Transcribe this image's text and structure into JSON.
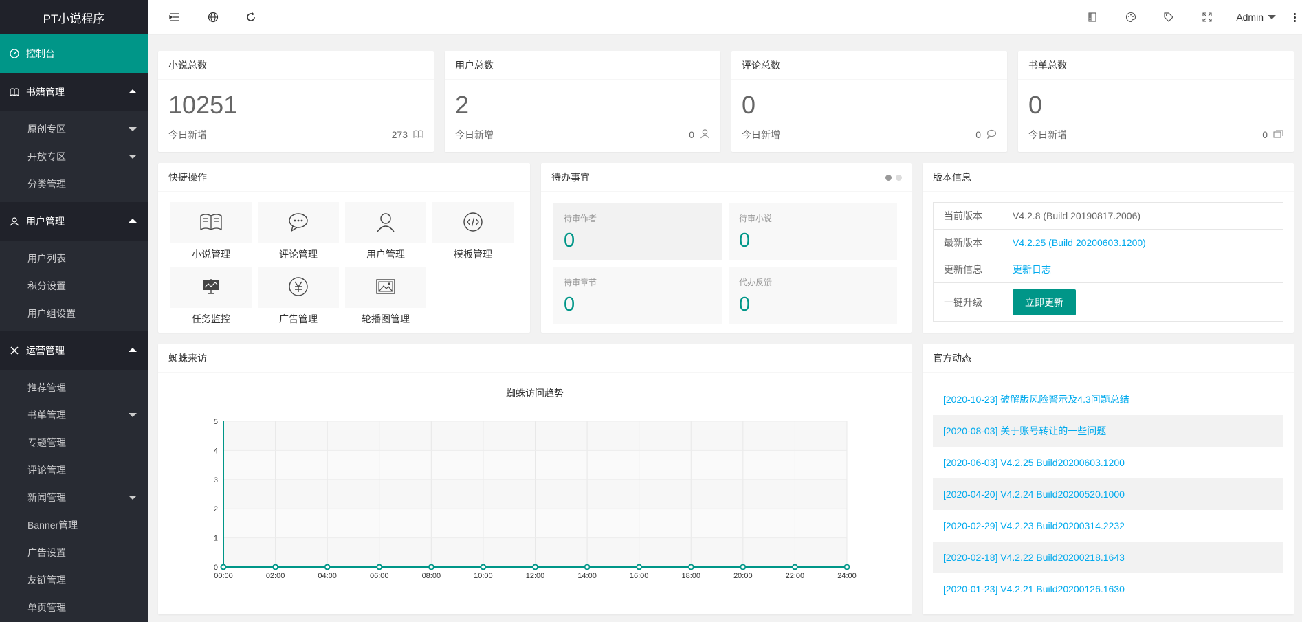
{
  "app": {
    "title": "PT小说程序"
  },
  "sidebar": {
    "home": "控制台",
    "groups": [
      {
        "label": "书籍管理",
        "items": [
          "原创专区",
          "开放专区",
          "分类管理"
        ]
      },
      {
        "label": "用户管理",
        "items": [
          "用户列表",
          "积分设置",
          "用户组设置"
        ]
      },
      {
        "label": "运营管理",
        "items": [
          "推荐管理",
          "书单管理",
          "专题管理",
          "评论管理",
          "新闻管理",
          "Banner管理",
          "广告设置",
          "友链管理",
          "单页管理"
        ]
      }
    ]
  },
  "header": {
    "user": "Admin"
  },
  "stats": [
    {
      "title": "小说总数",
      "value": "10251",
      "sub_label": "今日新增",
      "sub_value": "273",
      "icon": "book-icon"
    },
    {
      "title": "用户总数",
      "value": "2",
      "sub_label": "今日新增",
      "sub_value": "0",
      "icon": "user-icon"
    },
    {
      "title": "评论总数",
      "value": "0",
      "sub_label": "今日新增",
      "sub_value": "0",
      "icon": "comment-icon"
    },
    {
      "title": "书单总数",
      "value": "0",
      "sub_label": "今日新增",
      "sub_value": "0",
      "icon": "list-icon"
    }
  ],
  "quick": {
    "title": "快捷操作",
    "items": [
      "小说管理",
      "评论管理",
      "用户管理",
      "模板管理",
      "任务监控",
      "广告管理",
      "轮播图管理"
    ]
  },
  "todo": {
    "title": "待办事宜",
    "items": [
      {
        "label": "待审作者",
        "value": "0"
      },
      {
        "label": "待审小说",
        "value": "0"
      },
      {
        "label": "待审章节",
        "value": "0"
      },
      {
        "label": "代办反馈",
        "value": "0"
      }
    ]
  },
  "version": {
    "title": "版本信息",
    "rows": [
      {
        "k": "当前版本",
        "v": "V4.2.8 (Build 20190817.2006)"
      },
      {
        "k": "最新版本",
        "v": "V4.2.25 (Build 20200603.1200)"
      },
      {
        "k": "更新信息",
        "v": "更新日志"
      },
      {
        "k": "一键升级",
        "v": "立即更新"
      }
    ]
  },
  "spider": {
    "title": "蜘蛛来访"
  },
  "news": {
    "title": "官方动态",
    "items": [
      "[2020-10-23] 破解版风险警示及4.3问题总结",
      "[2020-08-03] 关于账号转让的一些问题",
      "[2020-06-03] V4.2.25 Build20200603.1200",
      "[2020-04-20] V4.2.24 Build20200520.1000",
      "[2020-02-29] V4.2.23 Build20200314.2232",
      "[2020-02-18] V4.2.22 Build20200218.1643",
      "[2020-01-23] V4.2.21 Build20200126.1630"
    ]
  },
  "colors": {
    "accent": "#009688",
    "link": "#01AAED",
    "sidebar": "#20222a"
  },
  "chart_data": {
    "type": "line",
    "title": "蜘蛛访问趋势",
    "x": [
      "00:00",
      "02:00",
      "04:00",
      "06:00",
      "08:00",
      "10:00",
      "12:00",
      "14:00",
      "16:00",
      "18:00",
      "20:00",
      "22:00",
      "24:00"
    ],
    "series": [
      {
        "values": [
          0,
          0,
          0,
          0,
          0,
          0,
          0,
          0,
          0,
          0,
          0,
          0,
          0
        ]
      }
    ],
    "ylim": [
      0,
      5
    ],
    "yticks": [
      0,
      1,
      2,
      3,
      4,
      5
    ],
    "grid": true
  }
}
